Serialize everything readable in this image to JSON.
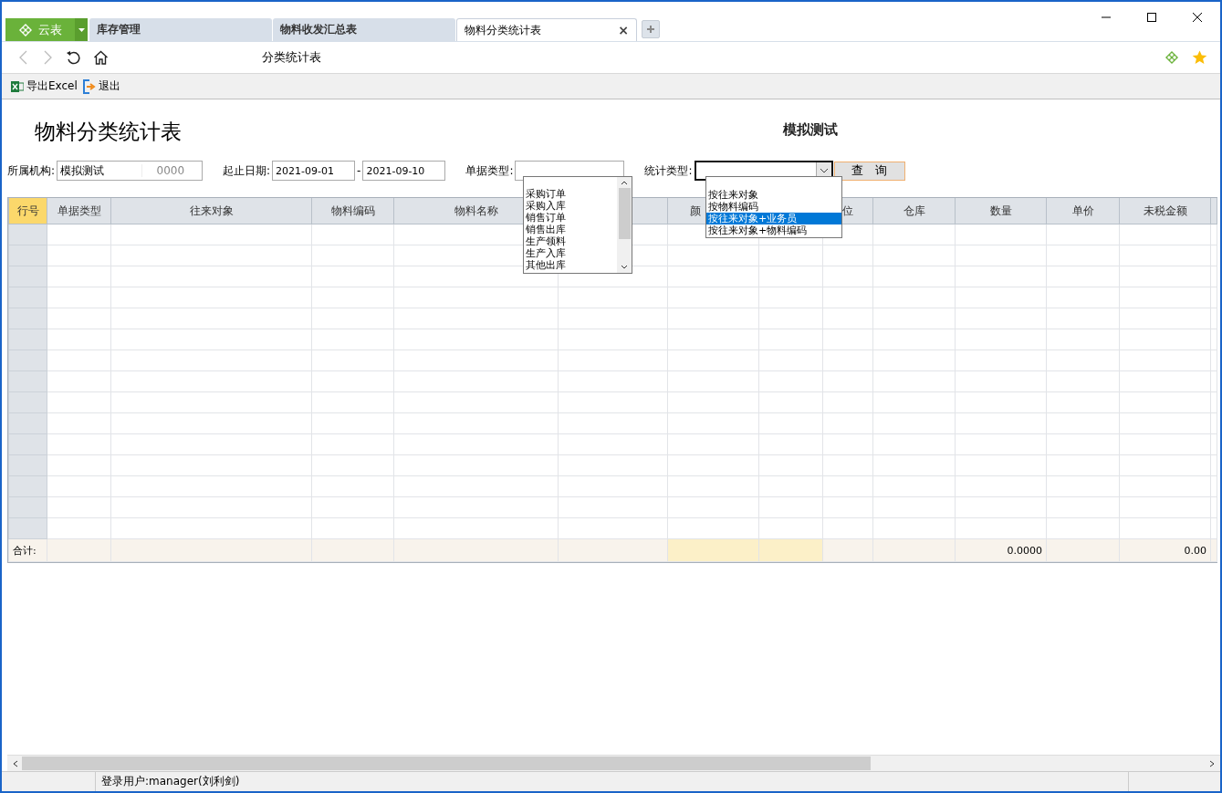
{
  "brand": "云表",
  "tabs": [
    {
      "label": "库存管理",
      "selected": false
    },
    {
      "label": "物料收发汇总表",
      "selected": false
    },
    {
      "label": "物料分类统计表",
      "selected": true
    }
  ],
  "tab_close": "×",
  "address": "分类统计表",
  "toolbar": [
    {
      "label": "导出Excel",
      "kind": "excel"
    },
    {
      "label": "退出",
      "kind": "exit"
    }
  ],
  "report": {
    "title": "物料分类统计表",
    "org_title": "模拟测试"
  },
  "filters": {
    "org_label": "所属机构:",
    "org_value": "模拟测试",
    "org_code": "0000",
    "date_label": "起止日期:",
    "date_from": "2021-09-01",
    "date_sep": "-",
    "date_to": "2021-09-10",
    "doc_type_label": "单据类型:",
    "stat_type_label": "统计类型:",
    "query_button": "查　询"
  },
  "doc_type_options": [
    "采购订单",
    "采购入库",
    "销售订单",
    "销售出库",
    "生产领料",
    "生产入库",
    "其他出库"
  ],
  "stat_type_options": [
    {
      "label": "按往来对象",
      "selected": false
    },
    {
      "label": "按物料编码",
      "selected": false
    },
    {
      "label": "按往来对象+业务员",
      "selected": true
    },
    {
      "label": "按往来对象+物料编码",
      "selected": false
    }
  ],
  "table": {
    "total_label": "合计:",
    "columns": [
      {
        "label": "行号",
        "kind": "row_number",
        "total_highlighted": false
      },
      {
        "label": "单据类型",
        "kind": "data",
        "total_highlighted": false
      },
      {
        "label": "往来对象",
        "kind": "data",
        "total_highlighted": false
      },
      {
        "label": "物料编码",
        "kind": "data",
        "total_highlighted": false
      },
      {
        "label": "物料名称",
        "kind": "data",
        "total_highlighted": false
      },
      {
        "kind": "data",
        "total_highlighted": false
      },
      {
        "label": "颜",
        "kind": "data",
        "total_highlighted": true
      },
      {
        "kind": "data",
        "total_highlighted": true
      },
      {
        "label": "位",
        "kind": "data",
        "total_highlighted": false
      },
      {
        "label": "仓库",
        "kind": "data",
        "total_highlighted": false
      },
      {
        "label": "数量",
        "kind": "data",
        "total_highlighted": false,
        "total": "0.0000"
      },
      {
        "label": "单价",
        "kind": "data",
        "total_highlighted": false
      },
      {
        "label": "未税金额",
        "kind": "data",
        "total_highlighted": false,
        "total": "0.00"
      }
    ]
  },
  "status_bar": {
    "user": "登录用户:manager(刘利剑)"
  }
}
